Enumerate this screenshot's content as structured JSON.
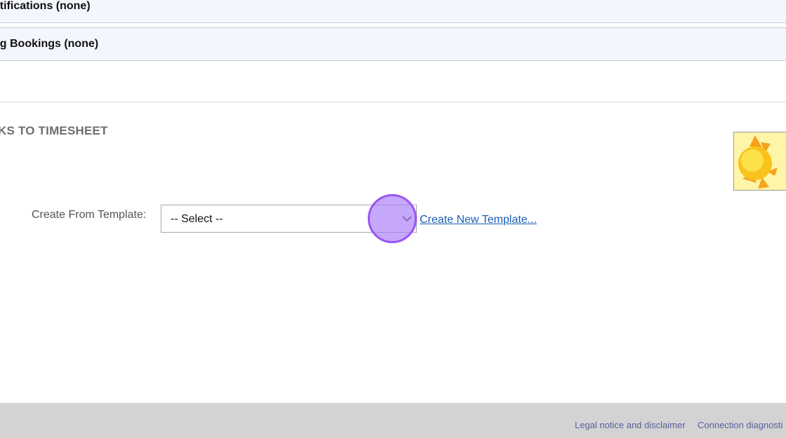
{
  "panels": {
    "notifications": "otifications (none)",
    "bookings": "ng Bookings (none)"
  },
  "section": {
    "title": "KS TO TIMESHEET"
  },
  "template": {
    "label": "Create From Template:",
    "select_value": "-- Select --",
    "create_link": "Create New Template..."
  },
  "footer": {
    "legal": "Legal notice and disclaimer",
    "diagnostics": "Connection diagnosti"
  },
  "colors": {
    "panel_bg": "#f4f6fe",
    "section_title": "#6e6e6e",
    "link": "#1a5fb4",
    "footer_bg": "#d3d3d3",
    "footer_link": "#5a5f9a",
    "click_marker": "#a678fa"
  },
  "icons": {
    "weather": "sun-icon",
    "dropdown": "chevron-down-icon"
  }
}
